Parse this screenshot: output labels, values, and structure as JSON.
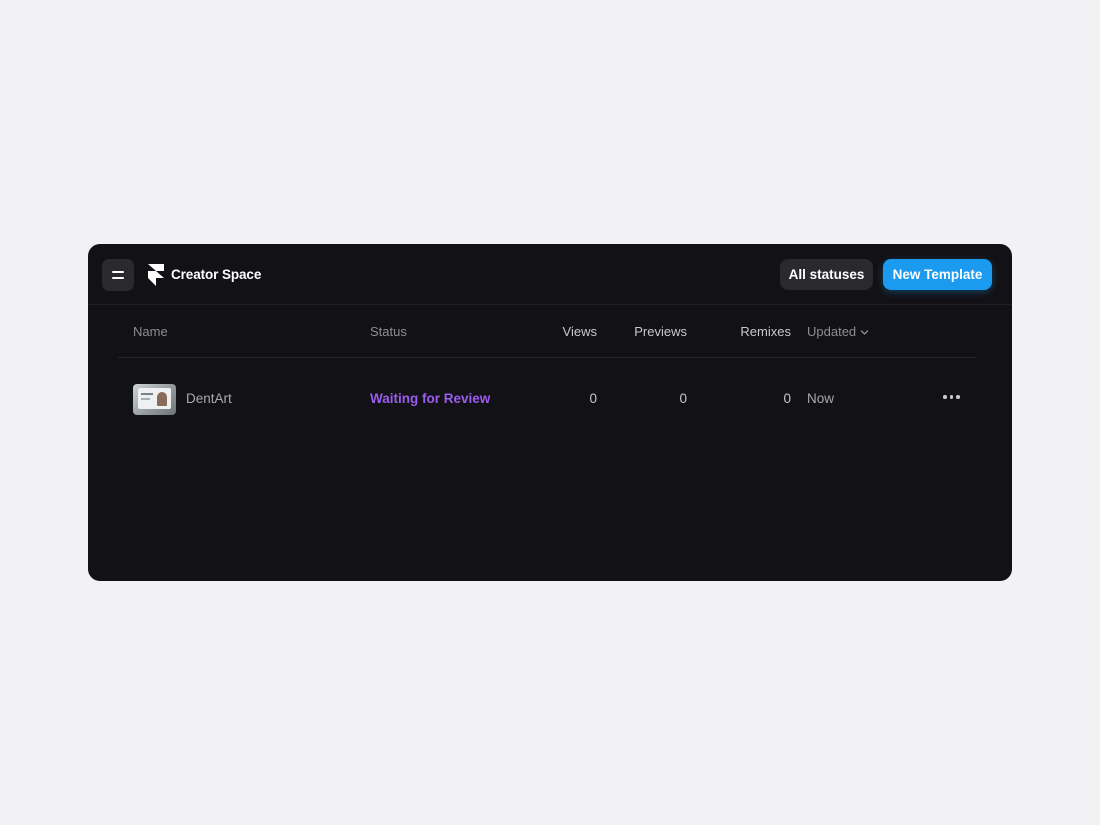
{
  "app": {
    "title": "Creator Space",
    "menu_icon": "menu-icon",
    "logo_icon": "framer-logo-icon"
  },
  "toolbar": {
    "filter_label": "All statuses",
    "new_label": "New Template"
  },
  "colors": {
    "accent": "#1a9bf0",
    "status_review": "#9b5cf0",
    "panel_bg": "#121115",
    "page_bg": "#f2f1f4"
  },
  "table": {
    "columns": {
      "name": "Name",
      "status": "Status",
      "views": "Views",
      "previews": "Previews",
      "remixes": "Remixes",
      "updated": "Updated"
    },
    "rows": [
      {
        "name": "DentArt",
        "status": "Waiting for Review",
        "views": "0",
        "previews": "0",
        "remixes": "0",
        "updated": "Now",
        "more_icon": "more-horizontal-icon"
      }
    ]
  }
}
